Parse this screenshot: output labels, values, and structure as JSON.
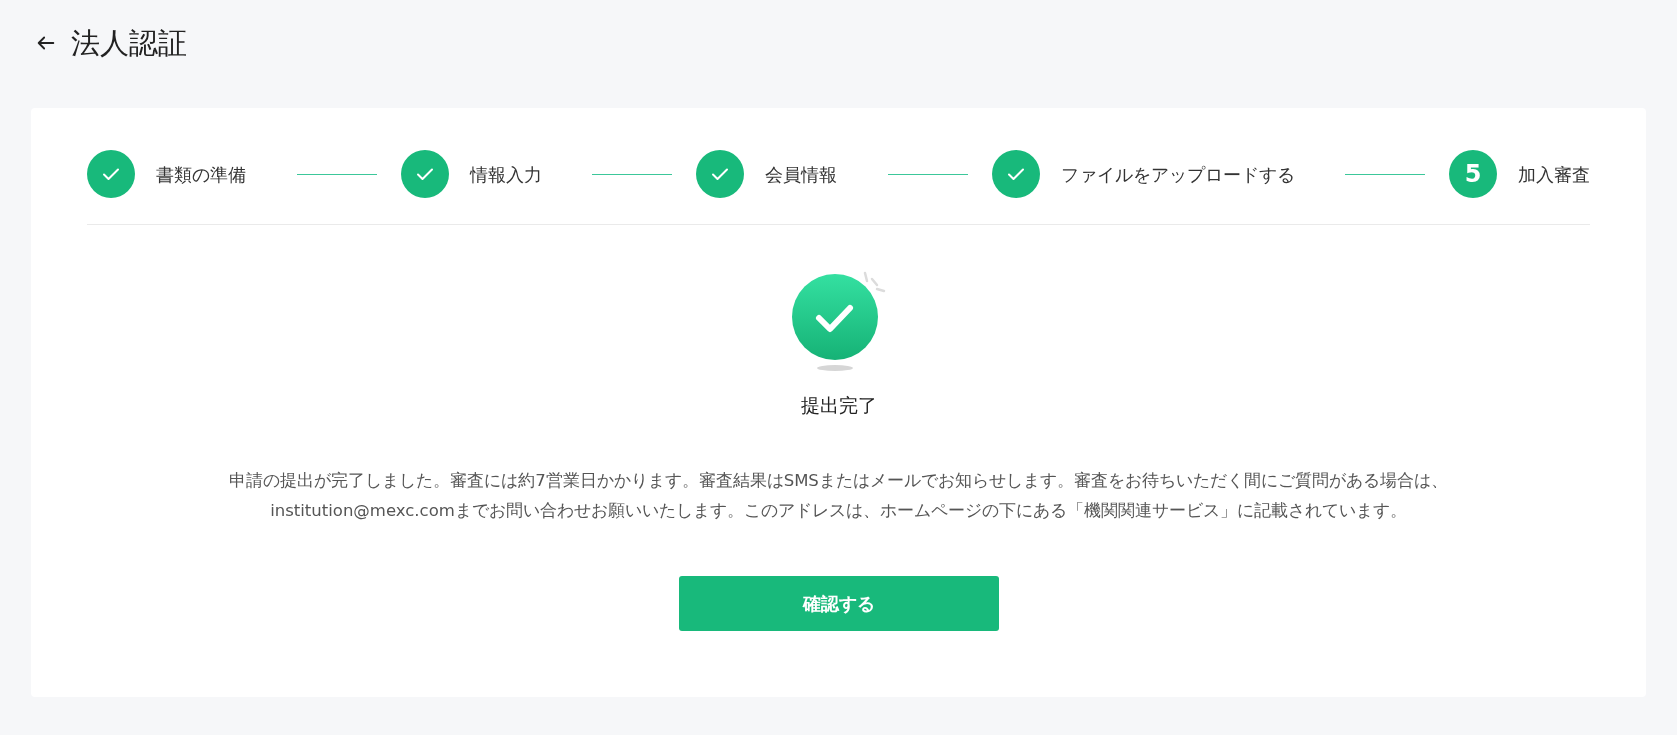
{
  "header": {
    "title": "法人認証"
  },
  "steps": [
    {
      "label": "書類の準備",
      "done": true
    },
    {
      "label": "情報入力",
      "done": true
    },
    {
      "label": "会員情報",
      "done": true
    },
    {
      "label": "ファイルをアップロードする",
      "done": true
    },
    {
      "label": "加入審査",
      "done": false,
      "number": "5"
    }
  ],
  "result": {
    "title": "提出完了",
    "message": "申請の提出が完了しました。審査には約7営業日かかります。審査結果はSMSまたはメールでお知らせします。審査をお待ちいただく間にご質問がある場合は、institution@mexc.comまでお問い合わせお願いいたします。このアドレスは、ホームページの下にある「機関関連サービス」に記載されています。"
  },
  "button": {
    "label": "確認する"
  }
}
